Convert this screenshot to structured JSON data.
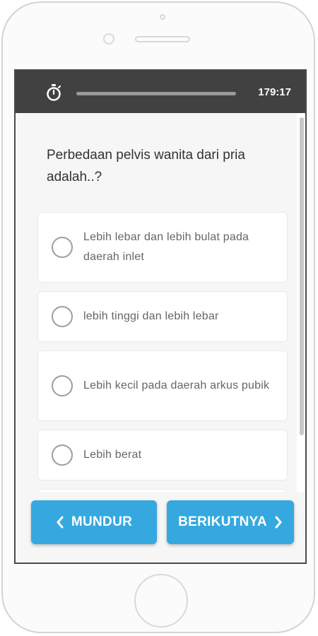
{
  "timer": {
    "remaining": "179:17",
    "progress_fraction": 0.0
  },
  "question": {
    "text": "Perbedaan pelvis wanita dari pria adalah..?"
  },
  "options": [
    {
      "label": "Lebih lebar dan lebih bulat pada daerah inlet"
    },
    {
      "label": "lebih tinggi dan lebih lebar"
    },
    {
      "label": "Lebih kecil pada daerah arkus pubik"
    },
    {
      "label": "Lebih berat"
    }
  ],
  "navigation": {
    "back_label": "MUNDUR",
    "next_label": "BERIKUTNYA"
  },
  "colors": {
    "topbar": "#414141",
    "button": "#35a8e0",
    "background": "#f6f6f6"
  },
  "icons": {
    "timer": "stopwatch-icon",
    "back": "chevron-left-icon",
    "next": "chevron-right-icon"
  }
}
